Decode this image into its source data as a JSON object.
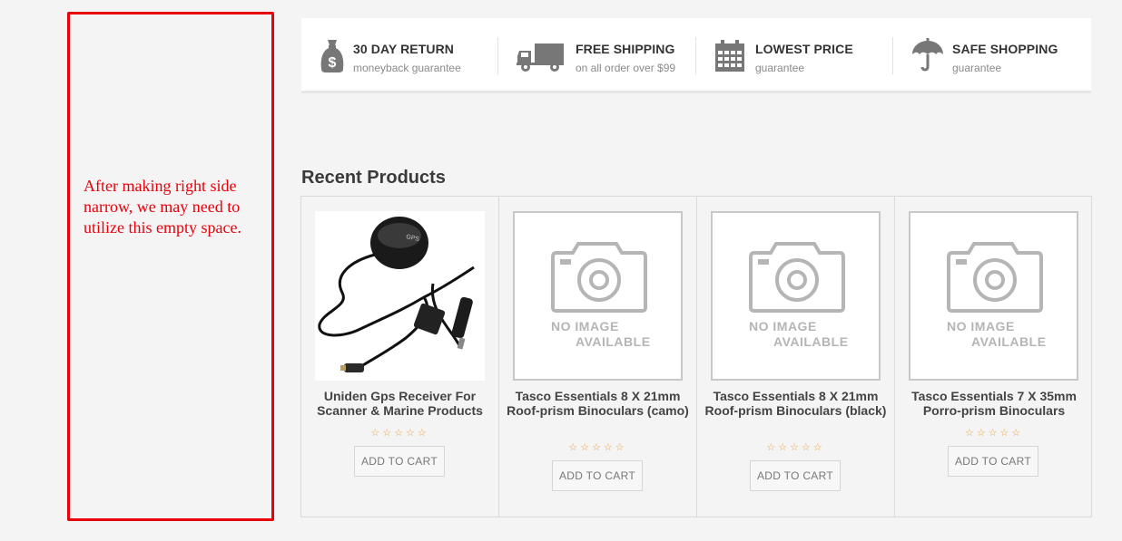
{
  "annotation": {
    "text": "After making right side narrow, we may need to utilize this empty space.",
    "color": "#e8000b"
  },
  "features": [
    {
      "icon": "money-bag-icon",
      "title": "30 DAY RETURN",
      "subtitle": "moneyback guarantee"
    },
    {
      "icon": "truck-icon",
      "title": "FREE SHIPPING",
      "subtitle": "on all order over $99"
    },
    {
      "icon": "calendar-icon",
      "title": "LOWEST PRICE",
      "subtitle": "guarantee"
    },
    {
      "icon": "umbrella-icon",
      "title": "SAFE SHOPPING",
      "subtitle": "guarantee"
    }
  ],
  "recent": {
    "title": "Recent Products",
    "products": [
      {
        "name": "Uniden Gps Receiver For Scanner & Marine Products",
        "image": "gps-receiver",
        "rating": "☆☆☆☆☆",
        "cart_label": "ADD TO CART"
      },
      {
        "name": "Tasco Essentials 8 X 21mm Roof-prism Binoculars (camo)",
        "image": "no-image",
        "rating": "☆☆☆☆☆",
        "cart_label": "ADD TO CART"
      },
      {
        "name": "Tasco Essentials 8 X 21mm Roof-prism Binoculars (black)",
        "image": "no-image",
        "rating": "☆☆☆☆☆",
        "cart_label": "ADD TO CART"
      },
      {
        "name": "Tasco Essentials 7 X 35mm Porro-prism Binoculars",
        "image": "no-image",
        "rating": "☆☆☆☆☆",
        "cart_label": "ADD TO CART"
      }
    ],
    "no_image_line1": "NO IMAGE",
    "no_image_line2": "AVAILABLE"
  },
  "colors": {
    "accent_star": "#e8a33a",
    "icon_gray": "#777777",
    "placeholder_gray": "#b5b5b5"
  }
}
